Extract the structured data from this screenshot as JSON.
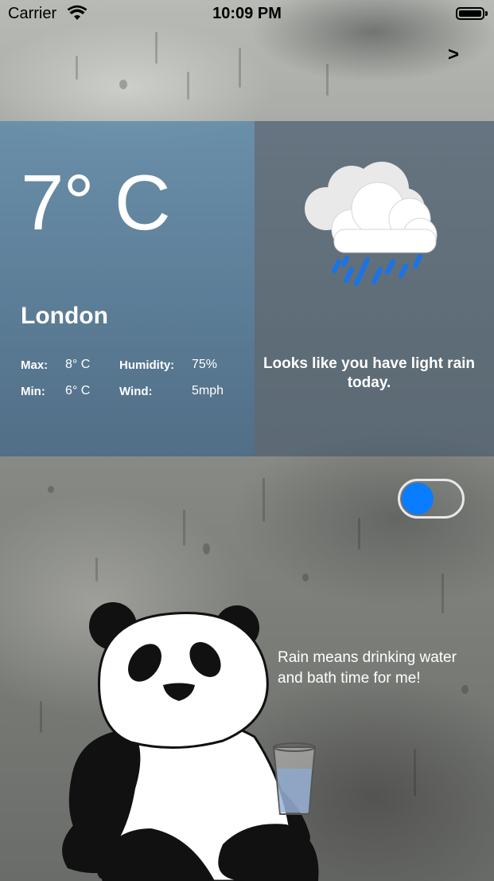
{
  "status_bar": {
    "carrier": "Carrier",
    "time": "10:09 PM"
  },
  "nav": {
    "next_label": ">"
  },
  "weather": {
    "temperature": "7° C",
    "city": "London",
    "max_label": "Max:",
    "max_value": "8° C",
    "min_label": "Min:",
    "min_value": "6° C",
    "humidity_label": "Humidity:",
    "humidity_value": "75%",
    "wind_label": "Wind:",
    "wind_value": "5mph",
    "icon": "cloud-rain-icon",
    "description": "Looks like you have light rain today."
  },
  "toggle": {
    "on": true,
    "color": "#0a7cff"
  },
  "panda": {
    "message": "Rain means drinking water and bath time for me!"
  }
}
